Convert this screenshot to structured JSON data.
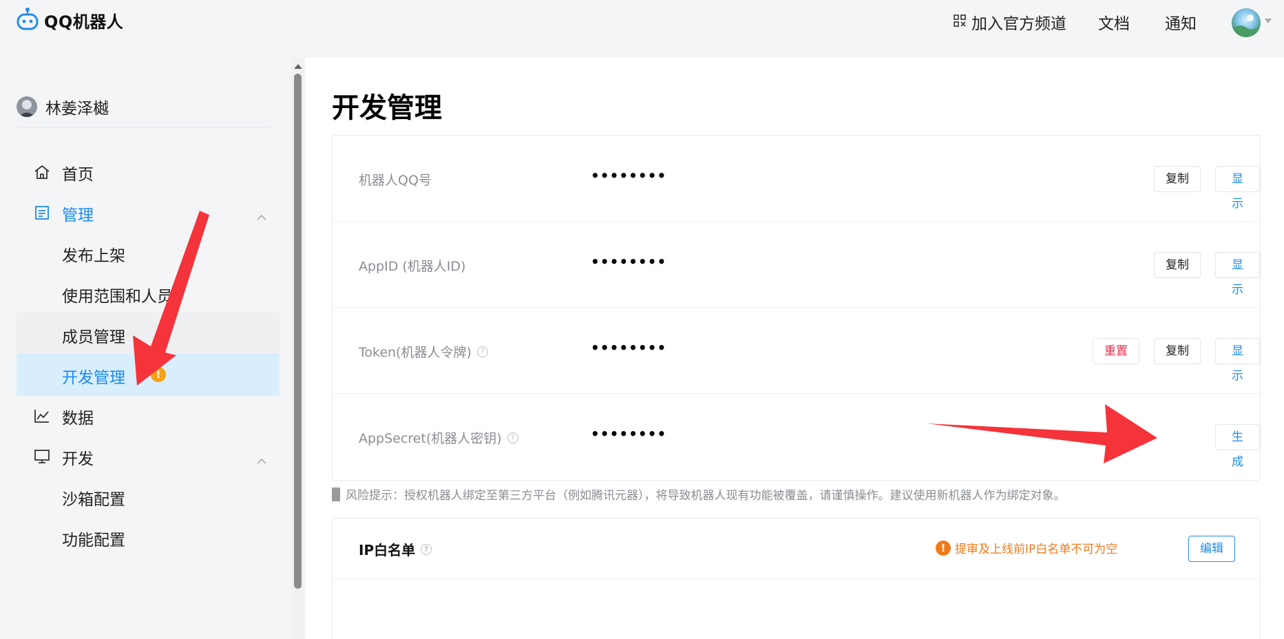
{
  "header": {
    "logo_text": "QQ机器人",
    "nav_join": "加入官方频道",
    "nav_docs": "文档",
    "nav_notice": "通知"
  },
  "sidebar": {
    "user_name": "林姜泽樾",
    "items": [
      {
        "label": "首页",
        "icon": "home-icon"
      },
      {
        "label": "管理",
        "icon": "manage-icon"
      },
      {
        "label": "发布上架"
      },
      {
        "label": "使用范围和人员"
      },
      {
        "label": "成员管理"
      },
      {
        "label": "开发管理",
        "badge": "!"
      },
      {
        "label": "数据",
        "icon": "chart-icon"
      },
      {
        "label": "开发",
        "icon": "monitor-icon"
      },
      {
        "label": "沙箱配置"
      },
      {
        "label": "功能配置"
      }
    ]
  },
  "main": {
    "title": "开发管理",
    "rows": [
      {
        "label": "机器人QQ号",
        "value": "••••••••",
        "copy": "复制",
        "show": "显示"
      },
      {
        "label": "AppID (机器人ID)",
        "value": "••••••••",
        "copy": "复制",
        "show": "显示"
      },
      {
        "label": "Token(机器人令牌)",
        "value": "••••••••",
        "reset": "重置",
        "copy": "复制",
        "show": "显示"
      },
      {
        "label": "AppSecret(机器人密钥)",
        "value": "••••••••",
        "generate": "生成"
      }
    ],
    "risk_tip": "风险提示：授权机器人绑定至第三方平台（例如腾讯元器），将导致机器人现有功能被覆盖，请谨慎操作。建议使用新机器人作为绑定对象。",
    "ip_whitelist": {
      "title": "IP白名单",
      "warning": "提审及上线前IP白名单不可为空",
      "edit": "编辑"
    }
  },
  "colors": {
    "accent": "#1e8af0",
    "danger": "#e8264a",
    "warning": "#f07a1a",
    "arrow": "#f5333a"
  }
}
